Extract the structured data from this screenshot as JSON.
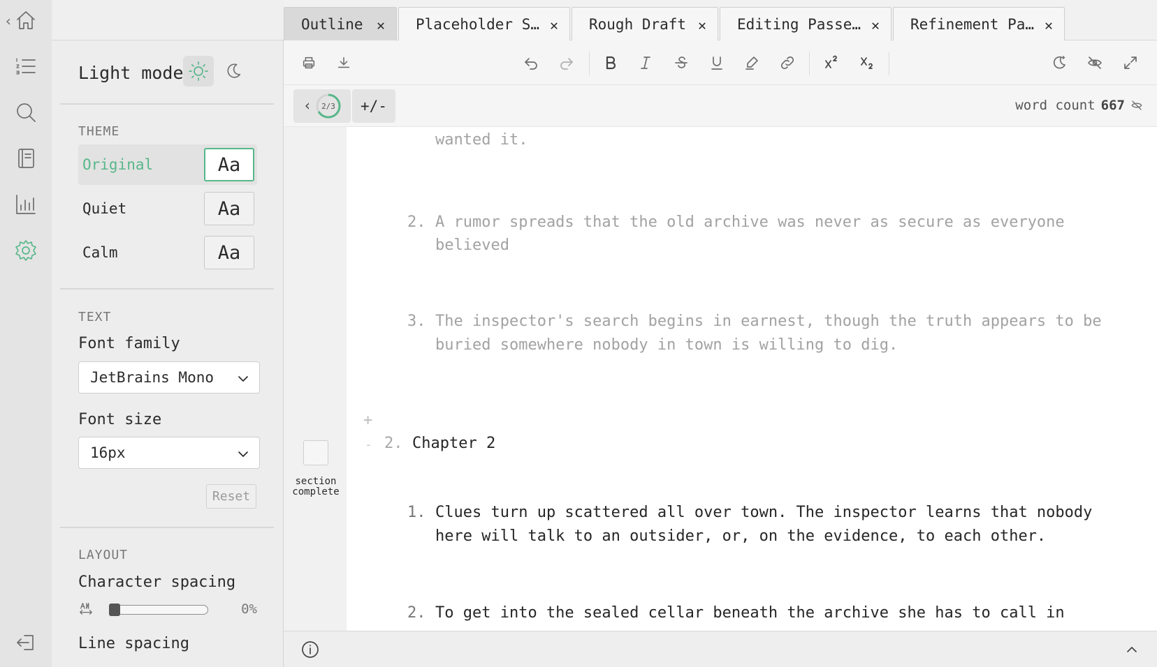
{
  "settings": {
    "mode_label": "Light mode",
    "theme": {
      "title": "THEME",
      "options": [
        {
          "name": "Original",
          "sample": "Aa",
          "selected": true
        },
        {
          "name": "Quiet",
          "sample": "Aa",
          "selected": false
        },
        {
          "name": "Calm",
          "sample": "Aa",
          "selected": false
        }
      ]
    },
    "text": {
      "title": "TEXT",
      "font_family_label": "Font family",
      "font_family_value": "JetBrains Mono",
      "font_size_label": "Font size",
      "font_size_value": "16px",
      "reset_label": "Reset"
    },
    "layout": {
      "title": "LAYOUT",
      "char_spacing_label": "Character spacing",
      "char_spacing_value": "0%",
      "char_spacing_fraction": 0,
      "line_spacing_label": "Line spacing"
    }
  },
  "tabs": [
    {
      "label": "Outline",
      "active": true
    },
    {
      "label": "Placeholder S…",
      "active": false
    },
    {
      "label": "Rough Draft",
      "active": false
    },
    {
      "label": "Editing Passe…",
      "active": false
    },
    {
      "label": "Refinement Pa…",
      "active": false
    }
  ],
  "subbar": {
    "progress_label": "2/3",
    "progress_fraction": 0.667,
    "diff_label": "+/-",
    "word_count_label": "word count",
    "word_count_value": "667"
  },
  "editor": {
    "section_complete_label_1": "section",
    "section_complete_label_2": "complete",
    "items": [
      {
        "num": "",
        "lines": [
          "wanted it."
        ],
        "faded": true
      },
      {
        "num": "2.",
        "lines": [
          "A rumor spreads that the old archive was never as secure as everyone",
          "believed"
        ],
        "faded": true
      },
      {
        "num": "3.",
        "lines": [
          "The inspector's search begins in earnest, though the truth appears to be",
          "buried somewhere nobody in town is willing to dig."
        ],
        "faded": true
      },
      {
        "num": "1.",
        "lines": [
          "Clues turn up scattered all over town. The inspector learns that nobody",
          "here will talk to an outsider, or, on the evidence, to each other."
        ],
        "faded": false
      },
      {
        "num": "2.",
        "lines": [
          "To get into the sealed cellar beneath the archive she has to call in"
        ],
        "faded": false
      }
    ],
    "chapter_plus": "+",
    "chapter_minus": "-",
    "chapter_num": "2.",
    "chapter_title": "Chapter 2"
  },
  "colors": {
    "accent": "#58b78a",
    "rail_bg": "#e4e4e4",
    "panel_bg": "#ededed"
  }
}
